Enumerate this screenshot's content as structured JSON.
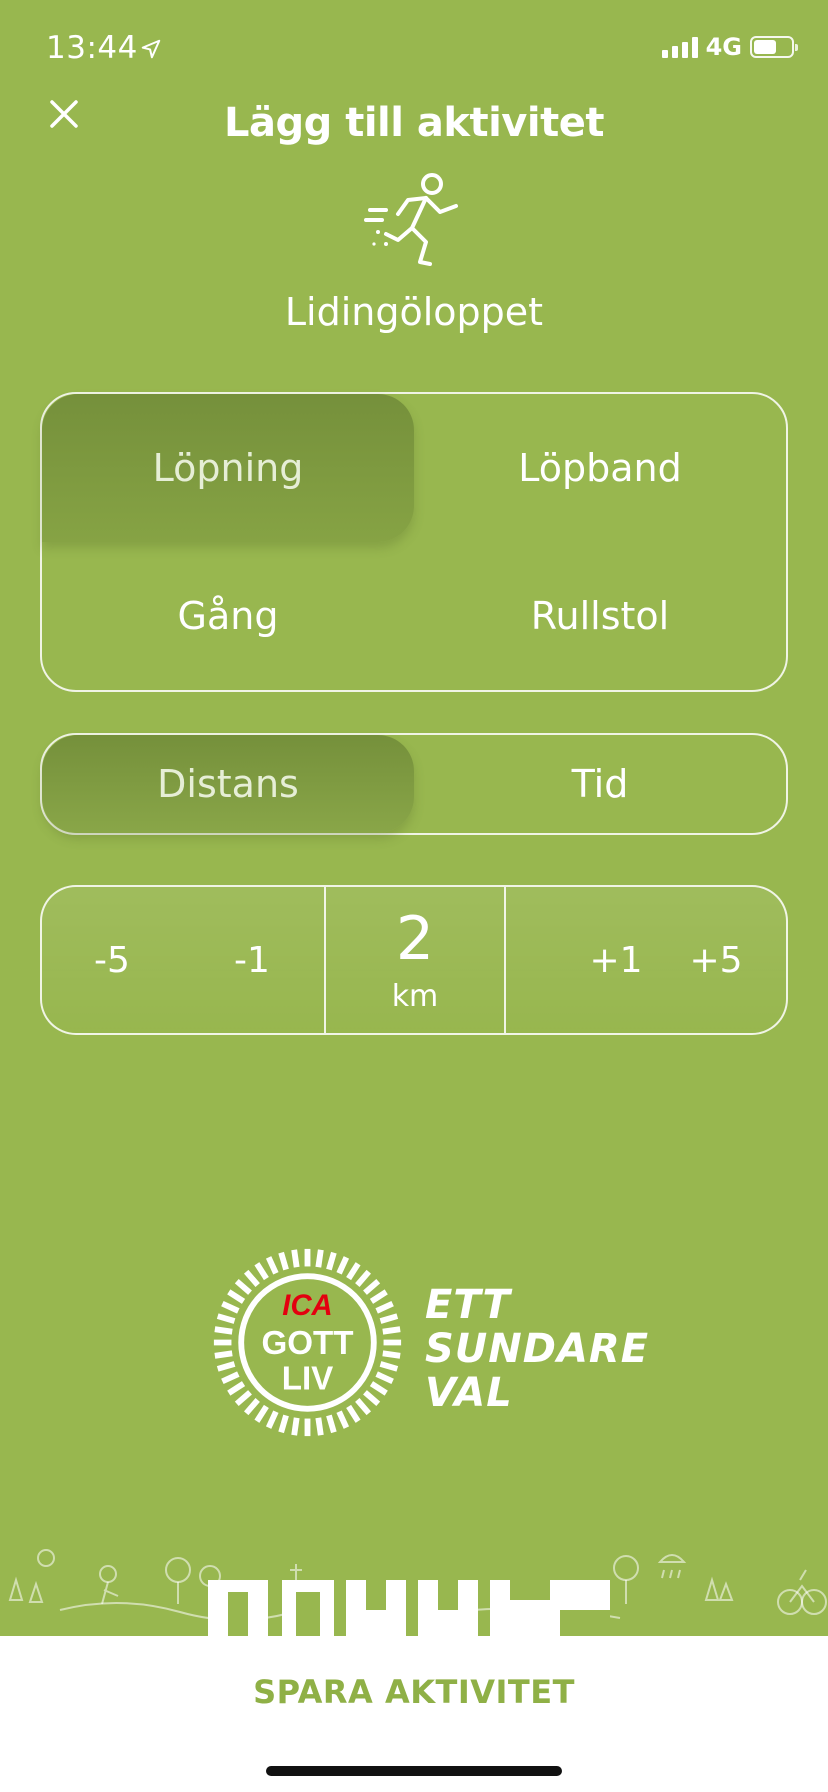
{
  "status_bar": {
    "time": "13:44",
    "network": "4G"
  },
  "header": {
    "title": "Lägg till aktivitet"
  },
  "activity": {
    "name": "Lidingöloppet",
    "icon": "running-person-icon"
  },
  "activity_types": [
    {
      "label": "Löpning",
      "selected": true
    },
    {
      "label": "Löpband",
      "selected": false
    },
    {
      "label": "Gång",
      "selected": false
    },
    {
      "label": "Rullstol",
      "selected": false
    }
  ],
  "measure_modes": [
    {
      "label": "Distans",
      "selected": true
    },
    {
      "label": "Tid",
      "selected": false
    }
  ],
  "stepper": {
    "minus5": "-5",
    "minus1": "-1",
    "value": "2",
    "unit": "km",
    "plus1": "+1",
    "plus5": "+5"
  },
  "logo": {
    "brand": "ICA",
    "seal_text": [
      "GOTT",
      "LIV"
    ],
    "tagline": [
      "ETT",
      "SUNDARE",
      "VAL"
    ]
  },
  "footer": {
    "save_label": "SPARA AKTIVITET"
  },
  "colors": {
    "background": "#98b74f",
    "selected": "#7a953e",
    "accent_text": "#8fb046",
    "ica_red": "#e3000f"
  }
}
